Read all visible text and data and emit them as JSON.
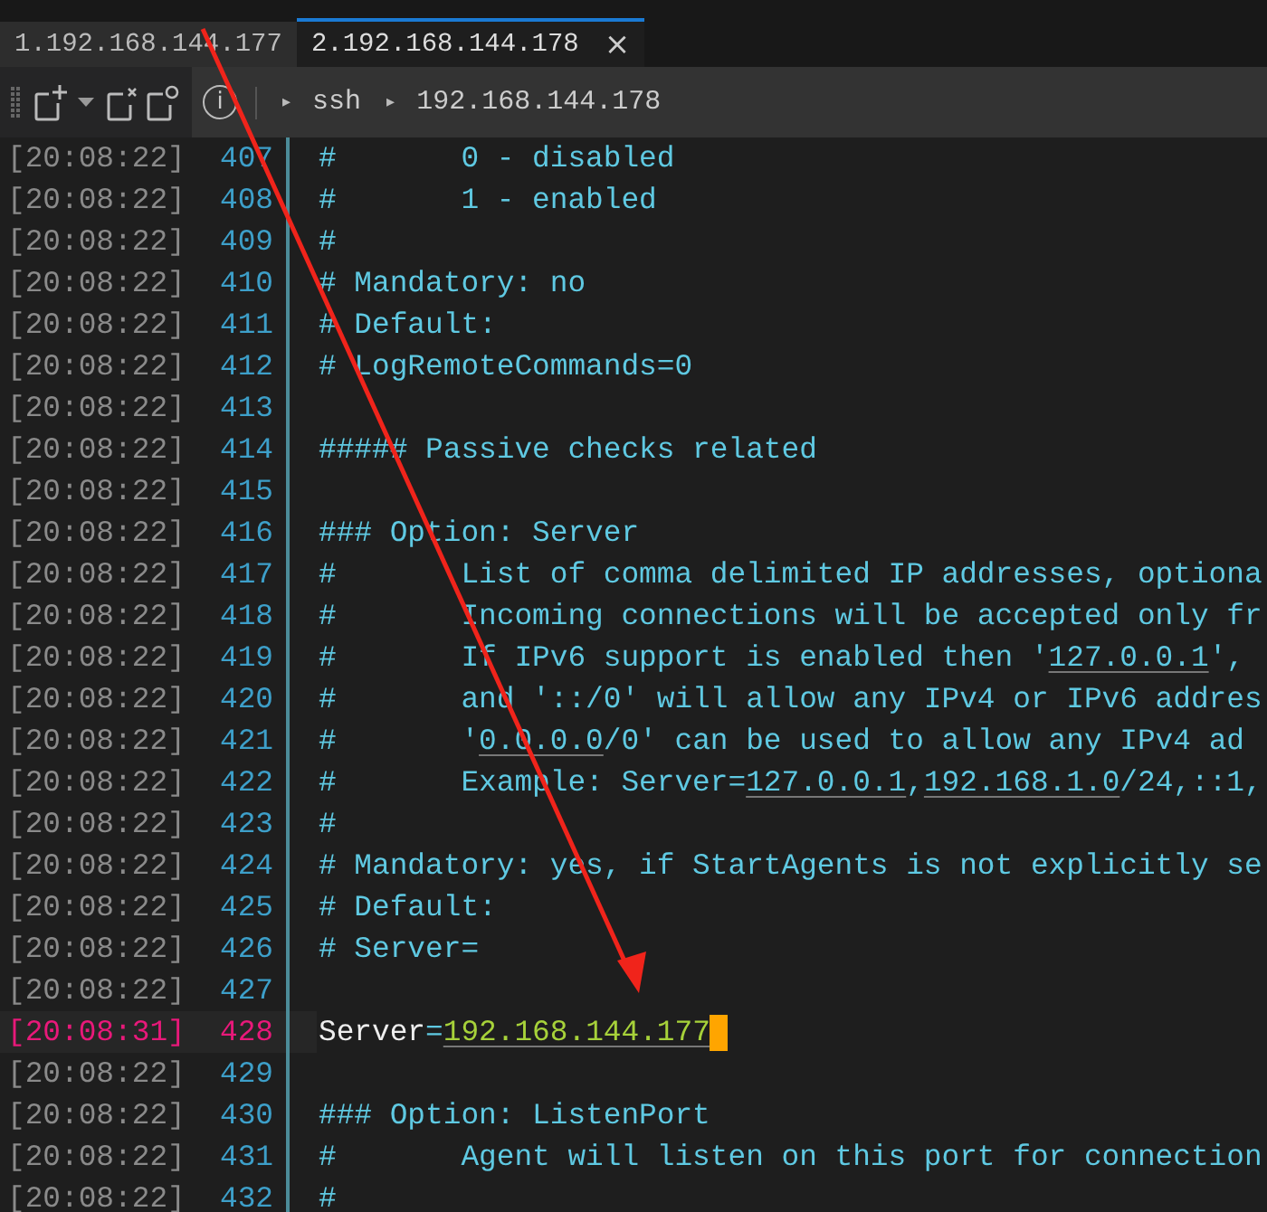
{
  "tabs": [
    {
      "label": "1.192.168.144.177",
      "selected": false
    },
    {
      "label": "2.192.168.144.178",
      "selected": true,
      "close": "×"
    }
  ],
  "toolbar": {
    "info": "i",
    "breadcrumb": [
      {
        "marker": "▸",
        "label": "ssh"
      },
      {
        "marker": "▸",
        "label": "192.168.144.178"
      }
    ]
  },
  "lines": [
    {
      "time": "[20:08:22]",
      "number": "407",
      "segments": [
        {
          "kind": "comment",
          "text": "#       0 - disabled"
        }
      ]
    },
    {
      "time": "[20:08:22]",
      "number": "408",
      "segments": [
        {
          "kind": "comment",
          "text": "#       1 - enabled"
        }
      ]
    },
    {
      "time": "[20:08:22]",
      "number": "409",
      "segments": [
        {
          "kind": "comment",
          "text": "#"
        }
      ]
    },
    {
      "time": "[20:08:22]",
      "number": "410",
      "segments": [
        {
          "kind": "comment",
          "text": "# Mandatory: no"
        }
      ]
    },
    {
      "time": "[20:08:22]",
      "number": "411",
      "segments": [
        {
          "kind": "comment",
          "text": "# Default:"
        }
      ]
    },
    {
      "time": "[20:08:22]",
      "number": "412",
      "segments": [
        {
          "kind": "comment",
          "text": "# LogRemoteCommands=0"
        }
      ]
    },
    {
      "time": "[20:08:22]",
      "number": "413"
    },
    {
      "time": "[20:08:22]",
      "number": "414",
      "segments": [
        {
          "kind": "comment",
          "text": "##### Passive checks related"
        }
      ]
    },
    {
      "time": "[20:08:22]",
      "number": "415"
    },
    {
      "time": "[20:08:22]",
      "number": "416",
      "segments": [
        {
          "kind": "comment",
          "text": "### Option: Server"
        }
      ]
    },
    {
      "time": "[20:08:22]",
      "number": "417",
      "segments": [
        {
          "kind": "comment",
          "text": "#       List of comma delimited IP addresses, optiona"
        }
      ]
    },
    {
      "time": "[20:08:22]",
      "number": "418",
      "segments": [
        {
          "kind": "comment",
          "text": "#       Incoming connections will be accepted only fr"
        }
      ]
    },
    {
      "time": "[20:08:22]",
      "number": "419",
      "segments": [
        {
          "kind": "comment",
          "text": "#       If IPv6 support is enabled then '"
        },
        {
          "kind": "link",
          "text": "127.0.0.1"
        },
        {
          "kind": "comment",
          "text": "',"
        }
      ]
    },
    {
      "time": "[20:08:22]",
      "number": "420",
      "segments": [
        {
          "kind": "comment",
          "text": "#       and '::/0' will allow any IPv4 or IPv6 addres"
        }
      ]
    },
    {
      "time": "[20:08:22]",
      "number": "421",
      "segments": [
        {
          "kind": "comment",
          "text": "#       '"
        },
        {
          "kind": "link",
          "text": "0.0.0.0"
        },
        {
          "kind": "comment",
          "text": "/0' can be used to allow any IPv4 ad"
        }
      ]
    },
    {
      "time": "[20:08:22]",
      "number": "422",
      "segments": [
        {
          "kind": "comment",
          "text": "#       Example: Server="
        },
        {
          "kind": "link",
          "text": "127.0.0.1"
        },
        {
          "kind": "comment",
          "text": ","
        },
        {
          "kind": "link",
          "text": "192.168.1.0"
        },
        {
          "kind": "comment",
          "text": "/24,::1,"
        }
      ]
    },
    {
      "time": "[20:08:22]",
      "number": "423",
      "segments": [
        {
          "kind": "comment",
          "text": "#"
        }
      ]
    },
    {
      "time": "[20:08:22]",
      "number": "424",
      "segments": [
        {
          "kind": "comment",
          "text": "# Mandatory: yes, if StartAgents is not explicitly se"
        }
      ]
    },
    {
      "time": "[20:08:22]",
      "number": "425",
      "segments": [
        {
          "kind": "comment",
          "text": "# Default:"
        }
      ]
    },
    {
      "time": "[20:08:22]",
      "number": "426",
      "segments": [
        {
          "kind": "comment",
          "text": "# Server="
        }
      ]
    },
    {
      "time": "[20:08:22]",
      "number": "427"
    },
    {
      "time": "[20:08:31]",
      "number": "428",
      "current": true,
      "cursor": true,
      "segments": [
        {
          "kind": "key",
          "text": "Server"
        },
        {
          "kind": "comment",
          "text": "="
        },
        {
          "kind": "value",
          "text": "192.168.144.177"
        }
      ]
    },
    {
      "time": "[20:08:22]",
      "number": "429"
    },
    {
      "time": "[20:08:22]",
      "number": "430",
      "segments": [
        {
          "kind": "comment",
          "text": "### Option: ListenPort"
        }
      ]
    },
    {
      "time": "[20:08:22]",
      "number": "431",
      "segments": [
        {
          "kind": "comment",
          "text": "#       Agent will listen on this port for connection"
        }
      ]
    },
    {
      "time": "[20:08:22]",
      "number": "432",
      "segments": [
        {
          "kind": "comment",
          "text": "#"
        }
      ]
    }
  ],
  "annotation": {
    "arrow": true
  }
}
